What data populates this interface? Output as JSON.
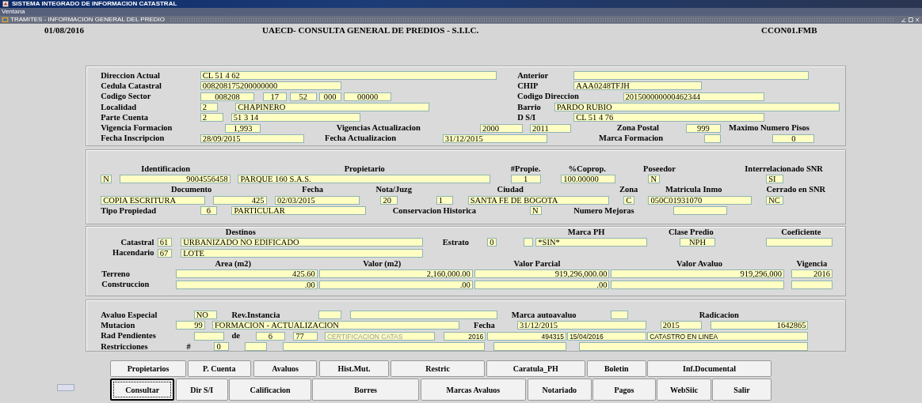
{
  "app_title": "SISTEMA INTEGRADO DE INFORMACION CATASTRAL",
  "menu": [
    "Ventana"
  ],
  "window_title": "TRAMITES - INFORMACION GENERAL DEL PREDIO",
  "header": {
    "date": "01/08/2016",
    "title": "UAECD- CONSULTA GENERAL DE PREDIOS - S.I.I.C.",
    "form": "CCON01.FMB"
  },
  "sections": [
    {
      "rows": [
        {
          "items": [
            {
              "kind": "label",
              "text": "Direccion Actual"
            },
            {
              "kind": "field",
              "value": "CL 51 4 62"
            },
            {
              "kind": "label",
              "text": "Anterior"
            },
            {
              "kind": "field"
            }
          ]
        },
        {
          "items": [
            {
              "kind": "label",
              "text": "Cedula Catastral"
            },
            {
              "kind": "field",
              "value": "008208175200000000"
            },
            {
              "kind": "label",
              "text": "CHIP"
            },
            {
              "kind": "field",
              "value": "AAA0248TFJH"
            }
          ]
        },
        {
          "items": [
            {
              "kind": "label",
              "text": "Codigo Sector"
            },
            {
              "kind": "field",
              "value": "008208"
            },
            {
              "kind": "field",
              "value": "17"
            },
            {
              "kind": "field",
              "value": "52"
            },
            {
              "kind": "field",
              "value": "000"
            },
            {
              "kind": "field",
              "value": "00000"
            },
            {
              "kind": "label",
              "text": "Codigo Direccion"
            },
            {
              "kind": "field",
              "value": "201500000000462344"
            }
          ]
        },
        {
          "items": [
            {
              "kind": "label",
              "text": "Localidad"
            },
            {
              "kind": "field",
              "value": "2"
            },
            {
              "kind": "field",
              "value": "CHAPINERO"
            },
            {
              "kind": "label",
              "text": "Barrio"
            },
            {
              "kind": "field",
              "value": "PARDO RUBIO"
            }
          ]
        },
        {
          "items": [
            {
              "kind": "label",
              "text": "Parte Cuenta"
            },
            {
              "kind": "field",
              "value": "2"
            },
            {
              "kind": "field",
              "value": "51 3 14"
            },
            {
              "kind": "label",
              "text": "D S/I"
            },
            {
              "kind": "field",
              "value": "CL 51 4 76"
            }
          ]
        },
        {
          "items": [
            {
              "kind": "label",
              "text": "Vigencia Formacion"
            },
            {
              "kind": "field",
              "value": "1,993"
            },
            {
              "kind": "label",
              "text": "Vigencias Actualizacion"
            },
            {
              "kind": "field",
              "value": "2000"
            },
            {
              "kind": "field",
              "value": "2011"
            },
            {
              "kind": "label",
              "text": "Zona Postal"
            },
            {
              "kind": "field",
              "value": "999"
            },
            {
              "kind": "label",
              "text": "Maximo Numero Pisos"
            }
          ]
        },
        {
          "items": [
            {
              "kind": "label",
              "text": "Fecha Inscripcion"
            },
            {
              "kind": "field",
              "value": "28/09/2015"
            },
            {
              "kind": "label",
              "text": "Fecha Actualizacion"
            },
            {
              "kind": "field",
              "value": "31/12/2015"
            },
            {
              "kind": "label",
              "text": "Marca Formacion"
            },
            {
              "kind": "field"
            },
            {
              "kind": "field",
              "value": "0"
            }
          ]
        }
      ]
    },
    {
      "rows": [
        {
          "items": [
            {
              "kind": "label",
              "text": "Identificacion"
            },
            {
              "kind": "label",
              "text": "Propietario"
            },
            {
              "kind": "label",
              "text": "#Propie."
            },
            {
              "kind": "label",
              "text": "%Coprop."
            },
            {
              "kind": "label",
              "text": "Poseedor"
            },
            {
              "kind": "label",
              "text": "Interrelacionado SNR"
            }
          ]
        },
        {
          "items": [
            {
              "kind": "field",
              "value": "N"
            },
            {
              "kind": "field",
              "value": "9004556458"
            },
            {
              "kind": "field",
              "value": "PARQUE 160 S.A.S."
            },
            {
              "kind": "field",
              "value": "1"
            },
            {
              "kind": "field",
              "value": "100.00000"
            },
            {
              "kind": "field",
              "value": "N"
            },
            {
              "kind": "field",
              "value": "SI"
            }
          ]
        },
        {
          "items": [
            {
              "kind": "label",
              "text": "Documento"
            },
            {
              "kind": "label",
              "text": "Fecha"
            },
            {
              "kind": "label",
              "text": "Nota/Juzg"
            },
            {
              "kind": "label",
              "text": "Ciudad"
            },
            {
              "kind": "label",
              "text": "Zona"
            },
            {
              "kind": "label",
              "text": "Matricula Inmo"
            },
            {
              "kind": "label",
              "text": "Cerrado en SNR"
            }
          ]
        },
        {
          "items": [
            {
              "kind": "field",
              "value": "COPIA ESCRITURA"
            },
            {
              "kind": "field",
              "value": "425"
            },
            {
              "kind": "field",
              "value": "02/03/2015"
            },
            {
              "kind": "field",
              "value": "20"
            },
            {
              "kind": "field",
              "value": "1"
            },
            {
              "kind": "field",
              "value": "SANTA FE DE BOGOTA"
            },
            {
              "kind": "field",
              "value": "C"
            },
            {
              "kind": "field",
              "value": "050C01931070"
            },
            {
              "kind": "field",
              "value": "NC"
            }
          ]
        },
        {
          "items": [
            {
              "kind": "label",
              "text": "Tipo Propiedad"
            },
            {
              "kind": "field",
              "value": "6"
            },
            {
              "kind": "field",
              "value": "PARTICULAR"
            },
            {
              "kind": "label",
              "text": "Conservacion Historica"
            },
            {
              "kind": "field",
              "value": "N"
            },
            {
              "kind": "label",
              "text": "Numero Mejoras"
            },
            {
              "kind": "field"
            }
          ]
        }
      ]
    },
    {
      "rows": [
        {
          "items": [
            {
              "kind": "label",
              "text": "Destinos"
            },
            {
              "kind": "label",
              "text": "Marca PH"
            },
            {
              "kind": "label",
              "text": "Clase Predio"
            },
            {
              "kind": "label",
              "text": "Coeficiente"
            }
          ]
        },
        {
          "items": [
            {
              "kind": "label",
              "text": "Catastral"
            },
            {
              "kind": "field",
              "value": "61"
            },
            {
              "kind": "field",
              "value": "URBANIZADO NO EDIFICADO"
            },
            {
              "kind": "label",
              "text": "Estrato"
            },
            {
              "kind": "field",
              "value": "0"
            },
            {
              "kind": "field"
            },
            {
              "kind": "field",
              "value": "*SIN*"
            },
            {
              "kind": "field",
              "value": "NPH"
            },
            {
              "kind": "field"
            }
          ]
        },
        {
          "items": [
            {
              "kind": "label",
              "text": "Hacendario"
            },
            {
              "kind": "field",
              "value": "67"
            },
            {
              "kind": "field",
              "value": "LOTE"
            }
          ]
        },
        {
          "items": [
            {
              "kind": "label",
              "text": "Area  (m2)"
            },
            {
              "kind": "label",
              "text": "Valor (m2)"
            },
            {
              "kind": "label",
              "text": "Valor Parcial"
            },
            {
              "kind": "label",
              "text": "Valor Avaluo"
            },
            {
              "kind": "label",
              "text": "Vigencia"
            }
          ]
        },
        {
          "items": [
            {
              "kind": "label",
              "text": "Terreno"
            },
            {
              "kind": "field",
              "value": "425.60"
            },
            {
              "kind": "field",
              "value": "2,160,000.00"
            },
            {
              "kind": "field",
              "value": "919,296,000.00"
            },
            {
              "kind": "field",
              "value": "919,296,000"
            },
            {
              "kind": "field",
              "value": "2016"
            }
          ]
        },
        {
          "items": [
            {
              "kind": "label",
              "text": "Construccion"
            },
            {
              "kind": "field",
              "value": ".00"
            },
            {
              "kind": "field",
              "value": ".00"
            },
            {
              "kind": "field",
              "value": ".00"
            },
            {
              "kind": "field"
            },
            {
              "kind": "field"
            }
          ]
        }
      ]
    },
    {
      "rows": [
        {
          "items": [
            {
              "kind": "label",
              "text": "Avaluo Especial"
            },
            {
              "kind": "field",
              "value": "NO"
            },
            {
              "kind": "label",
              "text": "Rev.Instancia"
            },
            {
              "kind": "field"
            },
            {
              "kind": "field"
            },
            {
              "kind": "label",
              "text": "Marca autoavaluo"
            },
            {
              "kind": "field"
            },
            {
              "kind": "label",
              "text": "Radicacion"
            }
          ]
        },
        {
          "items": [
            {
              "kind": "label",
              "text": "Mutacion"
            },
            {
              "kind": "field",
              "value": "99"
            },
            {
              "kind": "field",
              "value": "FORMACION - ACTUALIZACION"
            },
            {
              "kind": "label",
              "text": "Fecha"
            },
            {
              "kind": "field",
              "value": "31/12/2015"
            },
            {
              "kind": "field",
              "value": "2015"
            },
            {
              "kind": "field",
              "value": "1642865"
            }
          ]
        },
        {
          "items": [
            {
              "kind": "label",
              "text": "Rad Pendientes"
            },
            {
              "kind": "field"
            },
            {
              "kind": "label",
              "text": "de"
            },
            {
              "kind": "field",
              "value": "6"
            },
            {
              "kind": "field",
              "value": "77"
            },
            {
              "kind": "field",
              "value": "CERTIFICACION CATAS",
              "disabled": true
            },
            {
              "kind": "field",
              "value": "2016"
            },
            {
              "kind": "field",
              "value": "494315"
            },
            {
              "kind": "field",
              "value": "15/04/2016"
            },
            {
              "kind": "field",
              "value": "CATASTRO EN LINEA"
            }
          ]
        },
        {
          "items": [
            {
              "kind": "label",
              "text": "Restricciones"
            },
            {
              "kind": "label",
              "text": "#"
            },
            {
              "kind": "field",
              "value": "0"
            },
            {
              "kind": "field"
            },
            {
              "kind": "field"
            },
            {
              "kind": "field"
            },
            {
              "kind": "field"
            }
          ]
        }
      ]
    }
  ],
  "button_rows": [
    [
      {
        "label": "Propietarios",
        "focused": false
      },
      {
        "label": "P. Cuenta",
        "focused": false
      },
      {
        "label": "Avaluos",
        "focused": false
      },
      {
        "label": "Hist.Mut.",
        "focused": false
      },
      {
        "label": "Restric",
        "focused": false
      },
      {
        "label": "Caratula_PH",
        "focused": false
      },
      {
        "label": "Boletin",
        "focused": false
      },
      {
        "label": "Inf.Documental",
        "focused": false
      }
    ],
    [
      {
        "label": "Consultar",
        "focused": true
      },
      {
        "label": "Dir S/I",
        "focused": false
      },
      {
        "label": "Calificacion",
        "focused": false
      },
      {
        "label": "Borres",
        "focused": false
      },
      {
        "label": "Marcas Avaluos",
        "focused": false
      },
      {
        "label": "Notariado",
        "focused": false
      },
      {
        "label": "Pagos",
        "focused": false
      },
      {
        "label": "WebSiic",
        "focused": false
      },
      {
        "label": "Salir",
        "focused": false
      }
    ]
  ]
}
